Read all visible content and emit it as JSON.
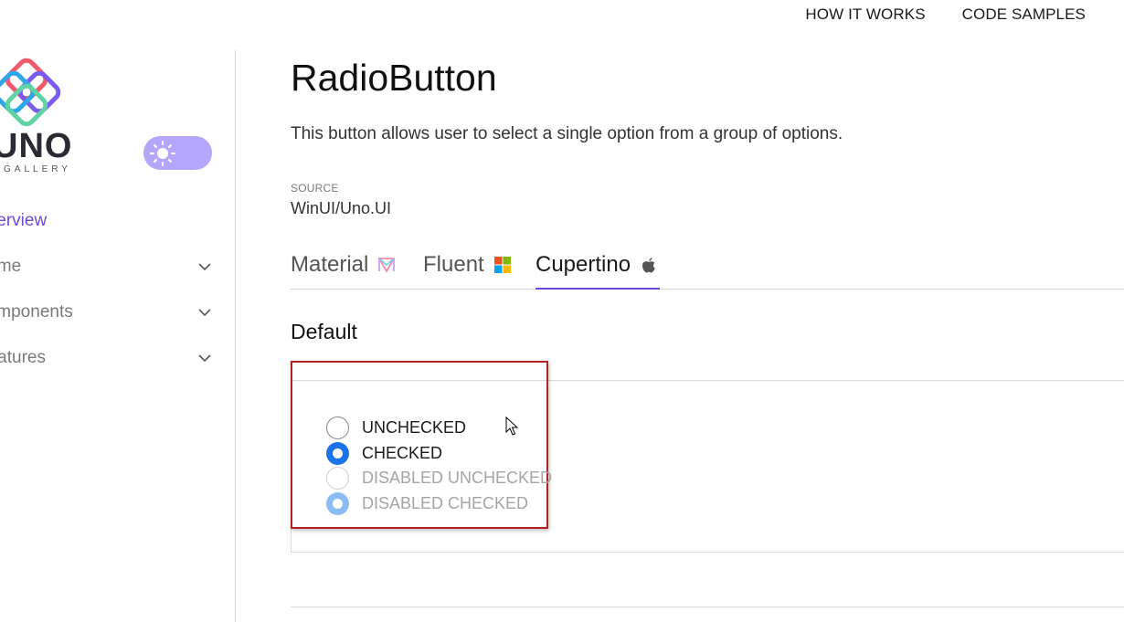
{
  "top_nav": {
    "how_it_works": "HOW IT WORKS",
    "code_samples": "CODE SAMPLES"
  },
  "sidebar": {
    "logo_text": "UNO",
    "logo_sub": "GALLERY",
    "theme_toggle": {
      "state": "light",
      "icon": "sun-icon",
      "color": "#b4a7fb"
    },
    "items": [
      {
        "label": "Overview",
        "active": true,
        "expandable": false
      },
      {
        "label": "Theme",
        "active": false,
        "expandable": true
      },
      {
        "label": "Components",
        "active": false,
        "expandable": true
      },
      {
        "label": "Features",
        "active": false,
        "expandable": true
      }
    ]
  },
  "main": {
    "title": "RadioButton",
    "description": "This button allows user to select a single option from a group of options.",
    "source_label": "SOURCE",
    "source_value": "WinUI/Uno.UI",
    "tabs": [
      {
        "label": "Material",
        "icon": "material-icon",
        "active": false
      },
      {
        "label": "Fluent",
        "icon": "windows-logo-icon",
        "active": false
      },
      {
        "label": "Cupertino",
        "icon": "apple-logo-icon",
        "active": true
      }
    ],
    "section_title": "Default",
    "radio_buttons": [
      {
        "label": "UNCHECKED",
        "checked": false,
        "disabled": false
      },
      {
        "label": "CHECKED",
        "checked": true,
        "disabled": false
      },
      {
        "label": "DISABLED UNCHECKED",
        "checked": false,
        "disabled": true
      },
      {
        "label": "DISABLED CHECKED",
        "checked": true,
        "disabled": true
      }
    ]
  },
  "colors": {
    "accent": "#6a4bd9",
    "radio_checked": "#1a73e8",
    "radio_disabled_checked": "#8cbcf5",
    "highlight_border": "#b22222"
  }
}
